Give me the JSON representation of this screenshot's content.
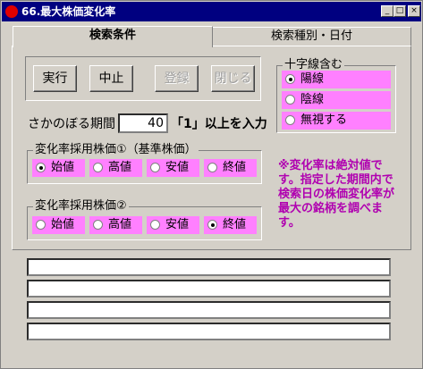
{
  "window": {
    "title": "66.最大株価変化率"
  },
  "tabs": [
    {
      "label": "検索条件",
      "active": true
    },
    {
      "label": "検索種別・日付",
      "active": false
    }
  ],
  "buttons": {
    "run": "実行",
    "stop": "中止",
    "register": "登録",
    "close": "閉じる"
  },
  "period": {
    "label": "さかのぼる期間",
    "value": "40",
    "hint": "「1」以上を入力"
  },
  "crossline": {
    "legend": "十字線含む",
    "options": [
      {
        "label": "陽線",
        "selected": true
      },
      {
        "label": "陰線",
        "selected": false
      },
      {
        "label": "無視する",
        "selected": false
      }
    ]
  },
  "price1": {
    "legend": "変化率採用株価①（基準株価）",
    "options": [
      {
        "label": "始値",
        "selected": true
      },
      {
        "label": "高値",
        "selected": false
      },
      {
        "label": "安値",
        "selected": false
      },
      {
        "label": "終値",
        "selected": false
      }
    ]
  },
  "price2": {
    "legend": "変化率採用株価②",
    "options": [
      {
        "label": "始値",
        "selected": false
      },
      {
        "label": "高値",
        "selected": false
      },
      {
        "label": "安値",
        "selected": false
      },
      {
        "label": "終値",
        "selected": true
      }
    ]
  },
  "note": "※変化率は絶対値です。指定した期間内で検索日の株価変化率が最大の銘柄を調べます。",
  "outputs": [
    "",
    "",
    "",
    ""
  ],
  "colors": {
    "highlight": "#ff80ff",
    "note": "#b000b0",
    "titlebar": "#000080"
  }
}
